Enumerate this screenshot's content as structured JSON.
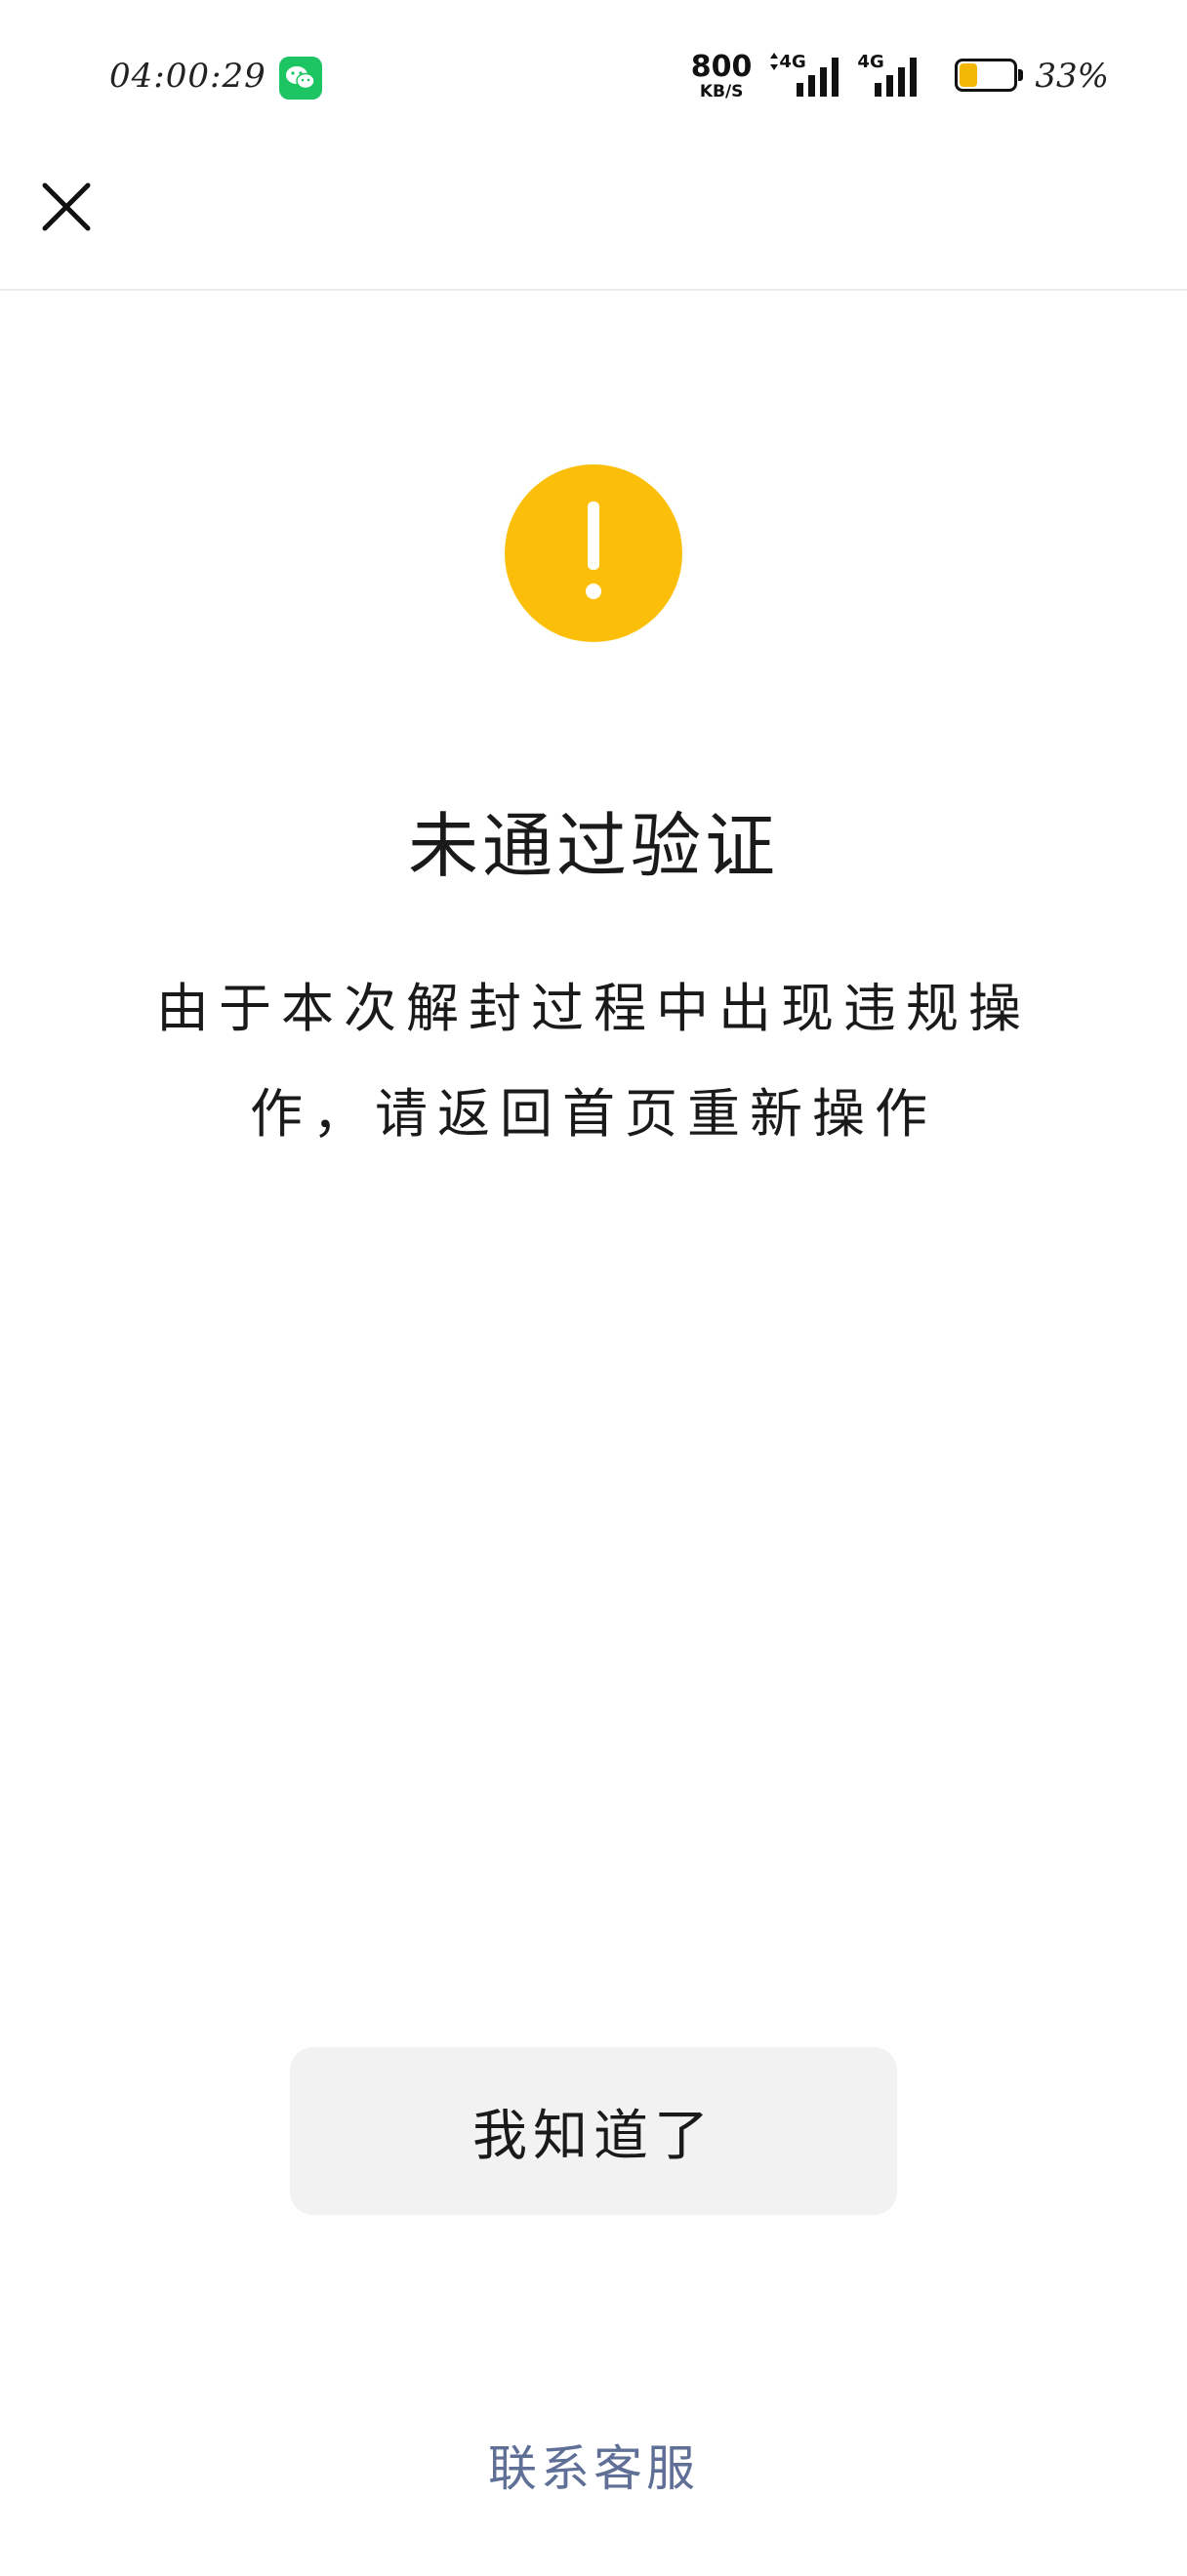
{
  "status_bar": {
    "time": "04:00:29",
    "net_speed_value": "800",
    "net_speed_unit": "KB/S",
    "signal_1_label": "4G",
    "signal_2_label": "4G",
    "battery_level": 0.33,
    "battery_percent": "33%",
    "battery_color": "#f2b705",
    "notification_icon": "wechat-icon"
  },
  "header": {
    "close_icon": "close-icon"
  },
  "result": {
    "icon": "warning-icon",
    "icon_color": "#fbbf0a",
    "title": "未通过验证",
    "description": "由于本次解封过程中出现违规操作，请返回首页重新操作"
  },
  "actions": {
    "ack_label": "我知道了",
    "support_label": "联系客服",
    "support_color": "#5f6f96"
  }
}
